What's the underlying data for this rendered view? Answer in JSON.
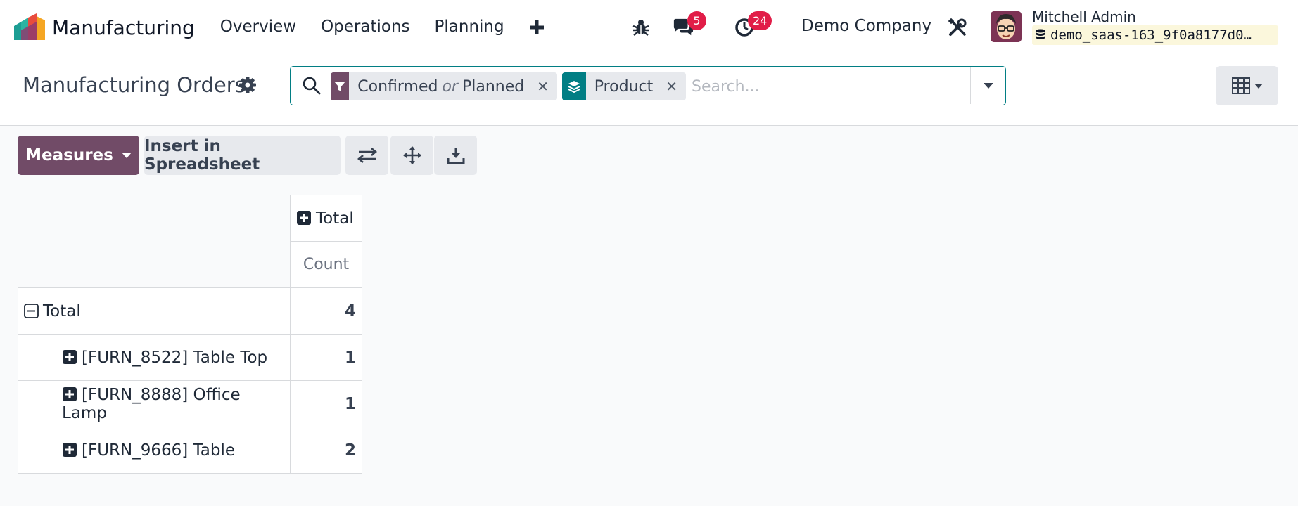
{
  "navbar": {
    "app_name": "Manufacturing",
    "menu": [
      "Overview",
      "Operations",
      "Planning"
    ],
    "add_menu_icon": "plus-icon",
    "debug_icon": "bug-icon",
    "messages_icon": "chat-icon",
    "messages_badge": "5",
    "activities_icon": "clock-icon",
    "activities_badge": "24",
    "company": "Demo Company",
    "settings_icon": "tools-icon",
    "user_name": "Mitchell Admin",
    "database": "demo_saas-163_9f0a8177d0…"
  },
  "control_panel": {
    "title": "Manufacturing Orders",
    "search": {
      "facets": [
        {
          "icon": "filter-icon",
          "color": "#714b67",
          "values": [
            "Confirmed",
            "Planned"
          ],
          "separator": "or"
        },
        {
          "icon": "layers-icon",
          "color": "#017e84",
          "values": [
            "Product"
          ]
        }
      ],
      "placeholder": "Search..."
    },
    "view_icon": "pivot-table-icon"
  },
  "actions": {
    "measures_label": "Measures",
    "insert_label": "Insert in Spreadsheet",
    "flip_icon": "flip-axis-icon",
    "expand_icon": "expand-all-icon",
    "download_icon": "download-icon"
  },
  "pivot": {
    "column_header": "Total",
    "measure": "Count",
    "total_row": {
      "label": "Total",
      "value": "4"
    },
    "rows": [
      {
        "label": "[FURN_8522] Table Top",
        "value": "1"
      },
      {
        "label": "[FURN_8888] Office Lamp",
        "value": "1"
      },
      {
        "label": "[FURN_9666] Table",
        "value": "2"
      }
    ]
  },
  "colors": {
    "brand_primary": "#714b67",
    "accent_teal": "#017e84",
    "badge_red": "#e11d48"
  }
}
